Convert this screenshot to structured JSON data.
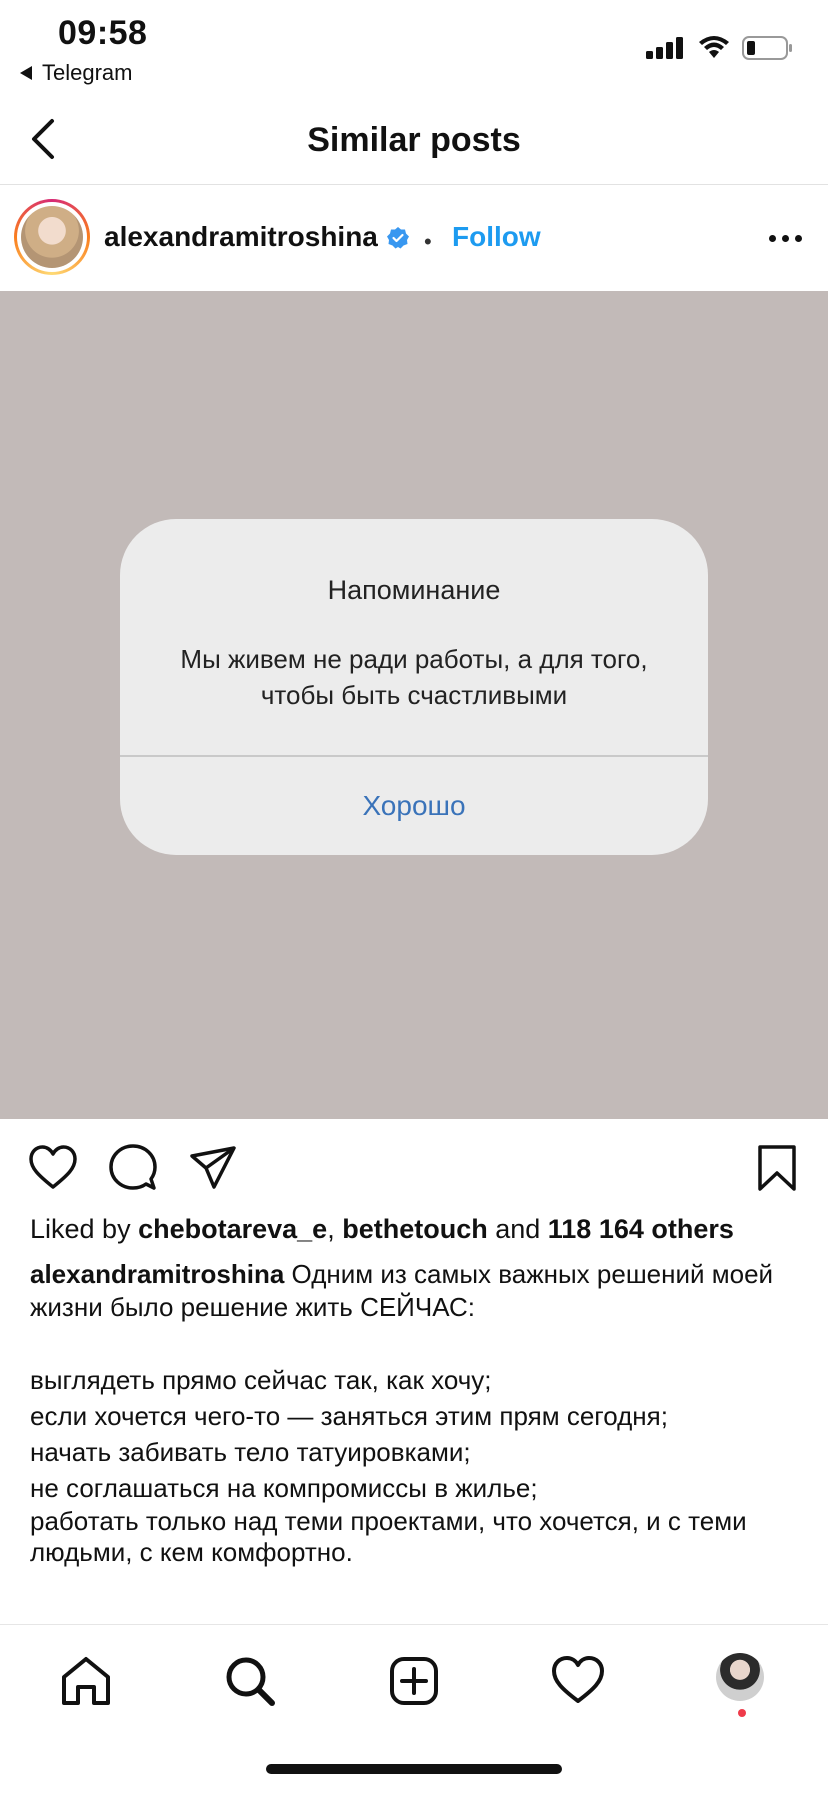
{
  "status_bar": {
    "time": "09:58",
    "back_app": "Telegram",
    "icons": [
      "signal-icon",
      "wifi-icon",
      "battery-icon"
    ]
  },
  "header": {
    "title": "Similar posts",
    "back_icon": "chevron-left-icon"
  },
  "post": {
    "username": "alexandramitroshina",
    "verified": true,
    "separator": "•",
    "follow_label": "Follow",
    "more_icon": "more-icon",
    "image_background": "#c2bab8",
    "alert": {
      "title": "Напоминание",
      "message": "Мы живем не ради работы, а для того, чтобы быть счастливыми",
      "button": "Хорошо",
      "button_color": "#3a73b9"
    },
    "actions": [
      "heart-icon",
      "comment-icon",
      "share-icon",
      "bookmark-icon"
    ],
    "likes": {
      "prefix": "Liked by ",
      "user1": "chebotareva_e",
      "comma": ", ",
      "user2": "bethetouch",
      "and": " and ",
      "others": "118 164 others"
    },
    "caption": {
      "username": "alexandramitroshina",
      "text": " Одним из самых важных решений моей жизни было решение жить СЕЙЧАС:",
      "lines": [
        "выглядеть прямо сейчас так, как хочу;",
        "если хочется чего-то — заняться этим прям сегодня;",
        "начать забивать тело татуировками;",
        "не соглашаться на компромиссы в жилье;",
        "работать только над теми проектами, что хочется, и с теми людьми, с кем комфортно."
      ]
    }
  },
  "bottom_nav": {
    "items": [
      "home-icon",
      "search-icon",
      "add-post-icon",
      "activity-heart-icon",
      "profile-avatar"
    ],
    "notification_color": "#ef3b4a"
  },
  "colors": {
    "accent_blue": "#1d9bf0",
    "verified_blue": "#3897f0"
  }
}
